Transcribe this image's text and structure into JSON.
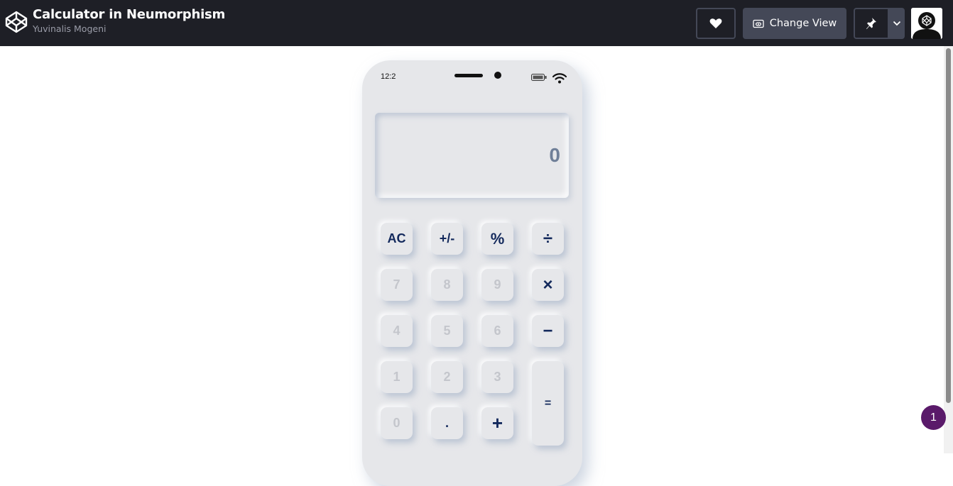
{
  "header": {
    "title": "Calculator in Neumorphism",
    "author": "Yuvinalis Mogeni",
    "change_view_label": "Change View",
    "icons": [
      "codepen-logo-icon",
      "heart-icon",
      "eye-icon",
      "pin-icon",
      "chevron-down-icon",
      "avatar"
    ]
  },
  "phone": {
    "status_time": "12:2",
    "display_value": "0"
  },
  "keys": {
    "ac": "AC",
    "plus_minus": "+/-",
    "percent": "%",
    "divide": "÷",
    "k7": "7",
    "k8": "8",
    "k9": "9",
    "multiply": "×",
    "k4": "4",
    "k5": "5",
    "k6": "6",
    "minus": "−",
    "k1": "1",
    "k2": "2",
    "k3": "3",
    "equals": "=",
    "k0": "0",
    "dot": ".",
    "plus": "+"
  },
  "notification_count": "1",
  "colors": {
    "topbar": "#1e1f26",
    "button_fill": "#444857",
    "surface": "#e6e7ea",
    "operator_text": "#13295c",
    "number_text": "#c4c6cc",
    "display_text": "#6f7f98",
    "badge": "#5a1a6a"
  }
}
